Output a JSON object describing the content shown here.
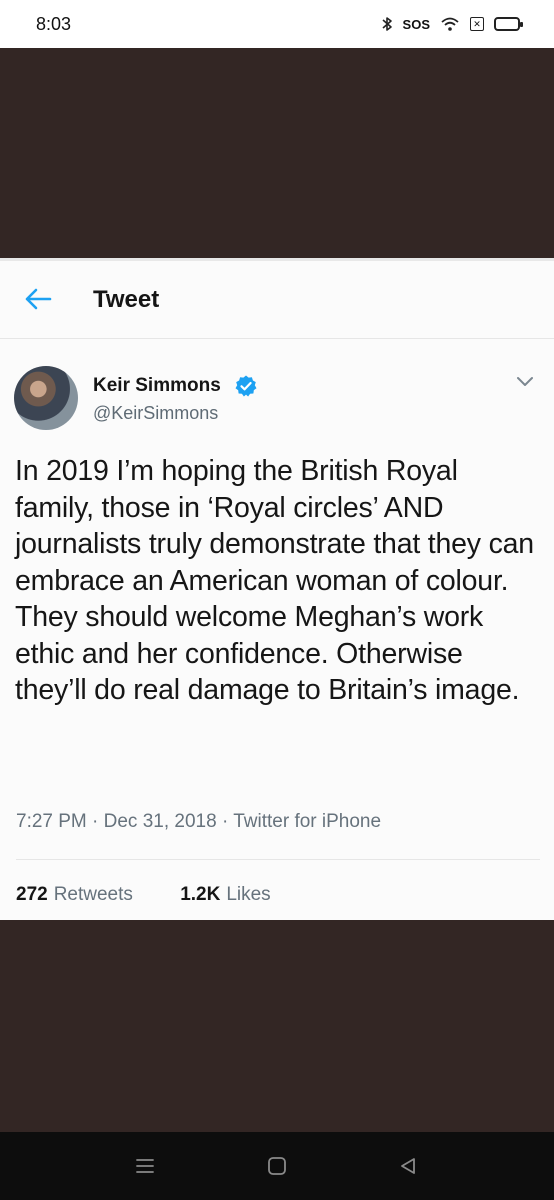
{
  "status_bar": {
    "time": "8:03",
    "sos": "SOS"
  },
  "tweet": {
    "header_title": "Tweet",
    "author": {
      "name": "Keir Simmons",
      "handle": "@KeirSimmons"
    },
    "text": "In 2019 I’m hoping the British Royal family, those in ‘Royal circles’ AND journalists truly demonstrate that they can embrace an American woman of colour. They should welcome Meghan’s work ethic and her confidence. Otherwise they’ll do real damage to Britain’s image.",
    "meta": "7:27 PM · Dec 31, 2018 · Twitter for iPhone",
    "retweets_count": "272",
    "retweets_label": "Retweets",
    "likes_count": "1.2K",
    "likes_label": "Likes"
  },
  "icons": {
    "back": "arrow-left-icon",
    "verified": "verified-badge-icon",
    "more": "chevron-down-icon",
    "bluetooth": "bluetooth-icon",
    "wifi": "wifi-icon",
    "sim": "sim-icon",
    "battery": "battery-icon"
  },
  "colors": {
    "accent_blue": "#1da1f2",
    "background": "#332624",
    "nav_bar": "#0d0d0d"
  }
}
